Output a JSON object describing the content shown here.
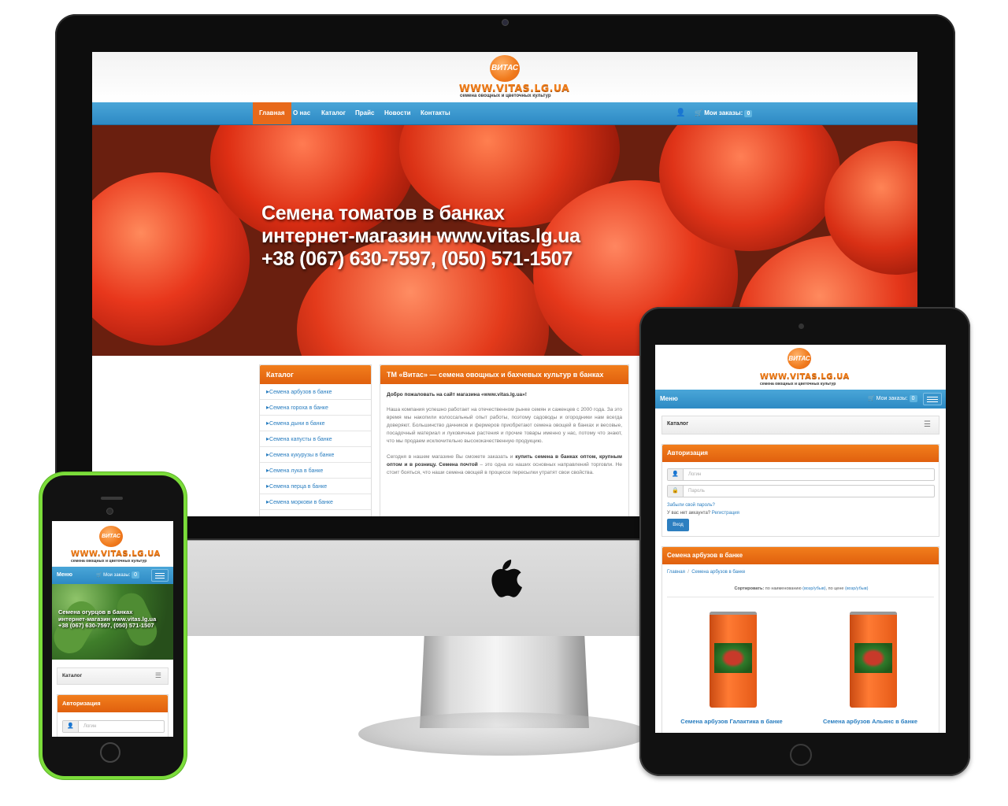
{
  "site": {
    "logo_badge": "ВИТАС",
    "logo_url": "WWW.VITAS.LG.UA",
    "logo_tagline": "семена овощных и цветочных культур"
  },
  "desktop": {
    "nav": {
      "items": [
        "Главная",
        "О нас",
        "Каталог",
        "Прайс",
        "Новости",
        "Контакты"
      ],
      "active": "Главная",
      "orders_label": "Мои заказы:",
      "orders_count": "0"
    },
    "hero": {
      "line1": "Семена томатов в банках",
      "line2": "интернет-магазин www.vitas.lg.ua",
      "line3": "+38 (067) 630-7597, (050) 571-1507"
    },
    "catalog": {
      "title": "Каталог",
      "items": [
        "Семена арбузов в банке",
        "Семена гороха в банке",
        "Семена дыни в банке",
        "Семена капусты в банке",
        "Семена кукурузы в банке",
        "Семена лука в банке",
        "Семена перца в банке",
        "Семена моркови в банке"
      ]
    },
    "main": {
      "title": "ТМ «Витас» — семена овощных и бахчевых культур в банках",
      "welcome": "Добро пожаловать на сайт магазина «www.vitas.lg.ua»!",
      "para1": "Наша компания успешно работает на отечественном рынке семян и саженцев с 2000 года. За это время мы накопили колоссальный опыт работы, поэтому садоводы и огородники нам всегда доверяют. Большинство дачников и фермеров приобретают семена овощей в банках и весовые, посадочный материал и луковичные растения и прочие товары именно у нас, потому что знают, что мы продаем исключительно высококачественную продукцию.",
      "para2_start": "Сегодня в нашем магазине Вы сможете заказать и ",
      "para2_bold": "купить семена в банках оптом, крупным оптом и в розницу. Семена почтой",
      "para2_end": " – это одна из наших основных направлений торговли. Не стоит бояться, что наши семена овощей в процессе пересылки утратят свои свойства."
    }
  },
  "tablet": {
    "menu_label": "Меню",
    "orders_label": "Мои заказы:",
    "orders_count": "0",
    "catalog_label": "Каталог",
    "auth": {
      "title": "Авторизация",
      "login_placeholder": "Логин",
      "password_placeholder": "Пароль",
      "forgot": "Забыли свой пароль?",
      "no_account": "У вас нет аккаунта?",
      "register": "Регистрация",
      "submit": "Вход"
    },
    "category": {
      "title": "Семена арбузов в банке",
      "breadcrumb_home": "Главная",
      "breadcrumb_sep": "/",
      "breadcrumb_current": "Семена арбузов в банке",
      "sort_label": "Сортировать:",
      "sort_name": "по наименованию",
      "sort_name_opts": "(возр/убыв)",
      "sort_price": "по цене",
      "sort_price_opts": "(возр/убыв)",
      "products": [
        "Семена арбузов Галактика в банке",
        "Семена арбузов Альянс в банке"
      ]
    }
  },
  "phone": {
    "menu_label": "Меню",
    "orders_label": "Мои заказы:",
    "orders_count": "0",
    "hero": {
      "line1": "Семена огурцов в банках",
      "line2": "интернет-магазин www.vitas.lg.ua",
      "line3": "+38 (067) 630-7597, (050) 571-1507"
    },
    "catalog_label": "Каталог",
    "auth_title": "Авторизация",
    "login_placeholder": "Логин"
  },
  "colors": {
    "accent_orange": "#e8691a",
    "nav_blue": "#3596cf",
    "link_blue": "#2a7ec0",
    "phone_green": "#7bdc3a"
  }
}
